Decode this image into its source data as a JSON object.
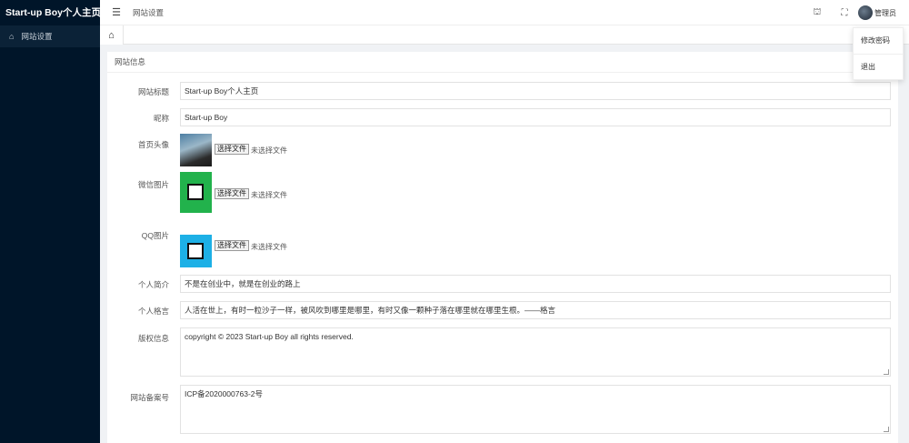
{
  "app": {
    "brand": "Start-up Boy个人主页"
  },
  "sidebar": {
    "items": [
      {
        "label": "网站设置",
        "icon": "home-icon"
      }
    ]
  },
  "header": {
    "page_title": "网站设置",
    "user_name": "管理员"
  },
  "user_menu": {
    "items": [
      "修改密码",
      "退出"
    ]
  },
  "card": {
    "title": "网站信息"
  },
  "form": {
    "site_name": {
      "label": "网站标题",
      "value": "Start-up Boy个人主页"
    },
    "nickname": {
      "label": "昵称",
      "value": "Start-up Boy"
    },
    "avatar": {
      "label": "首页头像",
      "button": "选择文件",
      "status": "未选择文件"
    },
    "wechat": {
      "label": "微信图片",
      "button": "选择文件",
      "status": "未选择文件"
    },
    "qq": {
      "label": "QQ图片",
      "button": "选择文件",
      "status": "未选择文件"
    },
    "profile": {
      "label": "个人简介",
      "value": "不是在创业中，就是在创业的路上"
    },
    "motto": {
      "label": "个人格言",
      "value": "人活在世上，有时一粒沙子一样，被风吹到哪里是哪里，有时又像一颗种子落在哪里就在哪里生根。——格言"
    },
    "copyright": {
      "label": "版权信息",
      "value": "copyright © 2023 Start-up Boy all rights reserved."
    },
    "icp": {
      "label": "网站备案号",
      "value": "ICP备2020000763-2号"
    }
  },
  "colors": {
    "sidebar": "#001529",
    "accent": "#1e9fff",
    "wechat": "#22b24c",
    "qq": "#1db0e6"
  }
}
